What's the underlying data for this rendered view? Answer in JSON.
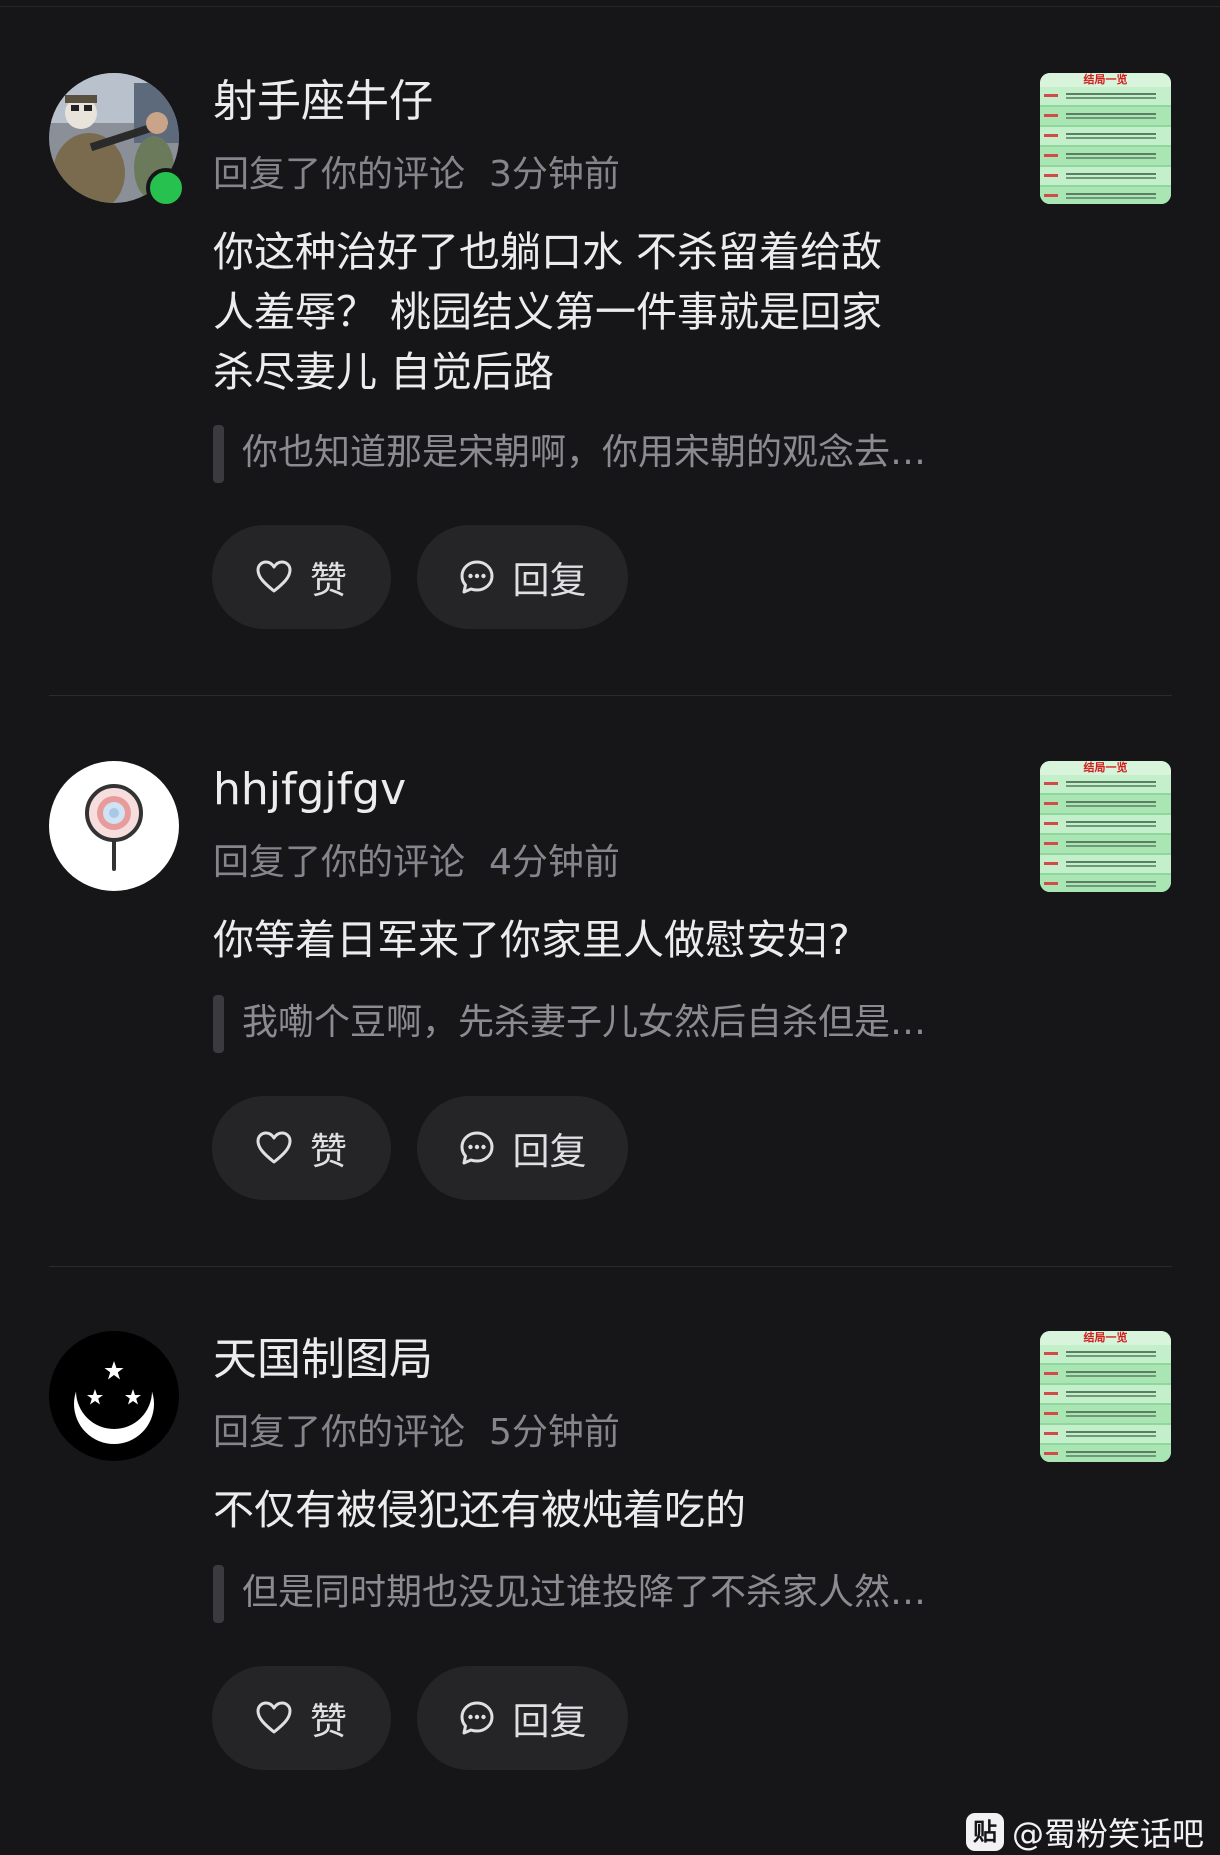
{
  "notifications": [
    {
      "username": "射手座牛仔",
      "action": "回复了你的评论",
      "time": "3分钟前",
      "online": true,
      "avatar_icon": "soldier-avatar-photo",
      "body_lines": [
        "你这种治好了也躺口水 不杀留着给敌",
        "人羞辱？ 桃园结义第一件事就是回家",
        "杀尽妻儿 自觉后路"
      ],
      "quote": "你也知道那是宋朝啊，你用宋朝的观念去…",
      "like_label": "赞",
      "reply_label": "回复",
      "thumb_title": "结局一览"
    },
    {
      "username": "hhjfgjfgv",
      "action": "回复了你的评论",
      "time": "4分钟前",
      "online": false,
      "avatar_icon": "lollipop-avatar",
      "body_lines": [
        "你等着日军来了你家里人做慰安妇?"
      ],
      "quote": "我嘞个豆啊，先杀妻子儿女然后自杀但是…",
      "like_label": "赞",
      "reply_label": "回复",
      "thumb_title": "结局一览"
    },
    {
      "username": "天国制图局",
      "action": "回复了你的评论",
      "time": "5分钟前",
      "online": false,
      "avatar_icon": "crescent-stars-avatar",
      "body_lines": [
        "不仅有被侵犯还有被炖着吃的"
      ],
      "quote": "但是同时期也没见过谁投降了不杀家人然…",
      "like_label": "赞",
      "reply_label": "回复",
      "thumb_title": "结局一览"
    }
  ],
  "watermark": {
    "logo_char": "贴",
    "text": "@蜀粉笑话吧"
  },
  "colors": {
    "background": "#161618",
    "button_bg": "#252528",
    "online": "#27c14f",
    "muted_text": "#85858b"
  }
}
